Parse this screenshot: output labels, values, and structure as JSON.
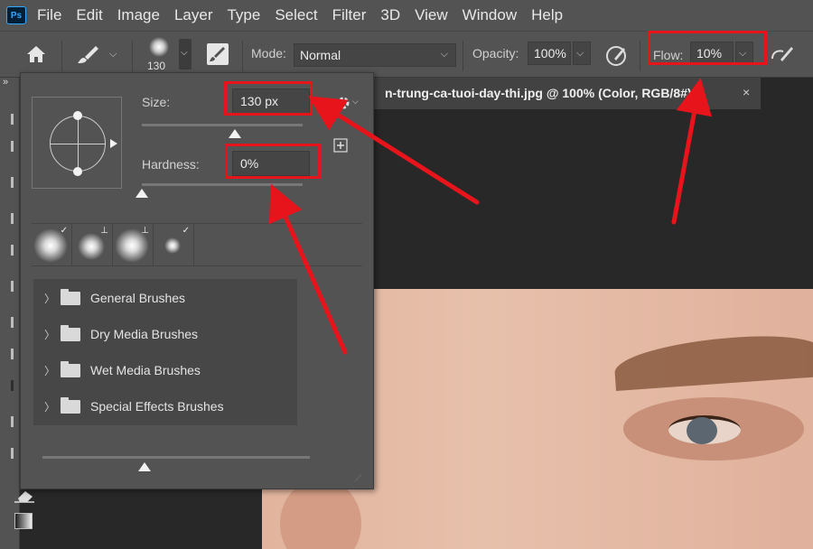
{
  "menubar": {
    "logo": "Ps",
    "items": [
      "File",
      "Edit",
      "Image",
      "Layer",
      "Type",
      "Select",
      "Filter",
      "3D",
      "View",
      "Window",
      "Help"
    ]
  },
  "options": {
    "brush_size": "130",
    "mode_label": "Mode:",
    "mode_value": "Normal",
    "opacity_label": "Opacity:",
    "opacity_value": "100%",
    "flow_label": "Flow:",
    "flow_value": "10%"
  },
  "document": {
    "tab_title": "n-trung-ca-tuoi-day-thi.jpg @ 100% (Color, RGB/8#) *",
    "close_symbol": "×"
  },
  "brush_panel": {
    "size_label": "Size:",
    "size_value": "130 px",
    "hardness_label": "Hardness:",
    "hardness_value": "0%",
    "folders": [
      "General Brushes",
      "Dry Media Brushes",
      "Wet Media Brushes",
      "Special Effects Brushes"
    ]
  },
  "colors": {
    "highlight": "#e8141c",
    "arrow": "#e8141c",
    "panel_bg": "#535353"
  }
}
